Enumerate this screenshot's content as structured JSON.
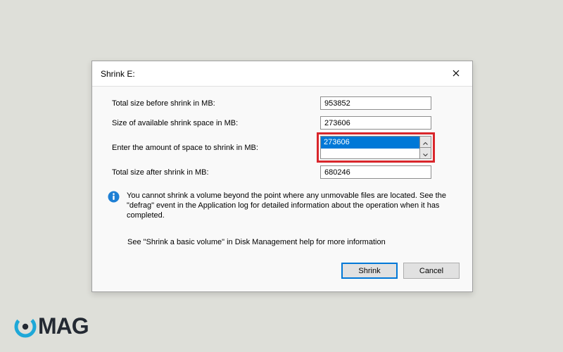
{
  "dialog": {
    "title": "Shrink E:",
    "rows": {
      "before": {
        "label": "Total size before shrink in MB:",
        "value": "953852"
      },
      "avail": {
        "label": "Size of available shrink space in MB:",
        "value": "273606"
      },
      "input": {
        "label": "Enter the amount of space to shrink in MB:",
        "value": "273606"
      },
      "after": {
        "label": "Total size after shrink in MB:",
        "value": "680246"
      }
    },
    "info_text": "You cannot shrink a volume beyond the point where any unmovable files are located. See the \"defrag\" event in the Application log for detailed information about the operation when it has completed.",
    "help_text": "See \"Shrink a basic volume\" in Disk Management help for more information",
    "buttons": {
      "shrink": "Shrink",
      "cancel": "Cancel"
    }
  },
  "brand": {
    "text": "MAG"
  }
}
